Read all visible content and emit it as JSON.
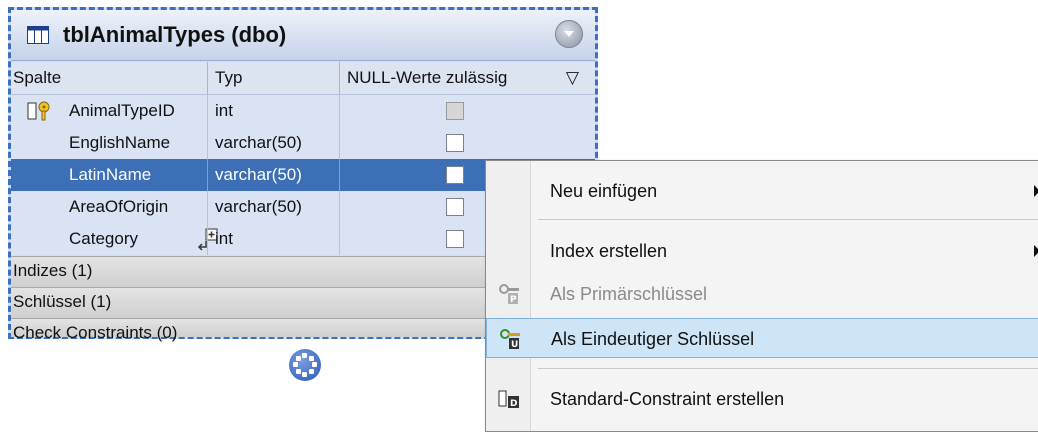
{
  "table": {
    "title": "tblAnimalTypes (dbo)",
    "columns_header": {
      "spalte": "Spalte",
      "typ": "Typ",
      "null": "NULL-Werte zulässig"
    },
    "rows": [
      {
        "name": "AnimalTypeID",
        "type": "int",
        "nullable": false,
        "primary_key": true,
        "selected": false
      },
      {
        "name": "EnglishName",
        "type": "varchar(50)",
        "nullable": false,
        "selected": false
      },
      {
        "name": "LatinName",
        "type": "varchar(50)",
        "nullable": false,
        "selected": true
      },
      {
        "name": "AreaOfOrigin",
        "type": "varchar(50)",
        "nullable": false,
        "selected": false
      },
      {
        "name": "Category",
        "type": "int",
        "nullable": false,
        "selected": false
      }
    ],
    "sections": {
      "indizes": "Indizes (1)",
      "schluessel": "Schlüssel (1)",
      "check": "Check Constraints (0)"
    }
  },
  "context_menu": {
    "items": [
      {
        "label": "Neu einfügen",
        "submenu": true
      },
      {
        "label": "Index erstellen",
        "submenu": true
      },
      {
        "label": "Als Primärschlüssel",
        "disabled": true,
        "icon": "primary-key-icon"
      },
      {
        "label": "Als Eindeutiger Schlüssel",
        "highlighted": true,
        "icon": "unique-key-icon"
      },
      {
        "label": "Standard-Constraint erstellen",
        "icon": "default-constraint-icon"
      }
    ]
  },
  "colors": {
    "selection": "#3c6fb5",
    "table_bg": "#d9e3f4",
    "menu_highlight": "#cde5f7",
    "border_dashed": "#3a6fc4"
  }
}
